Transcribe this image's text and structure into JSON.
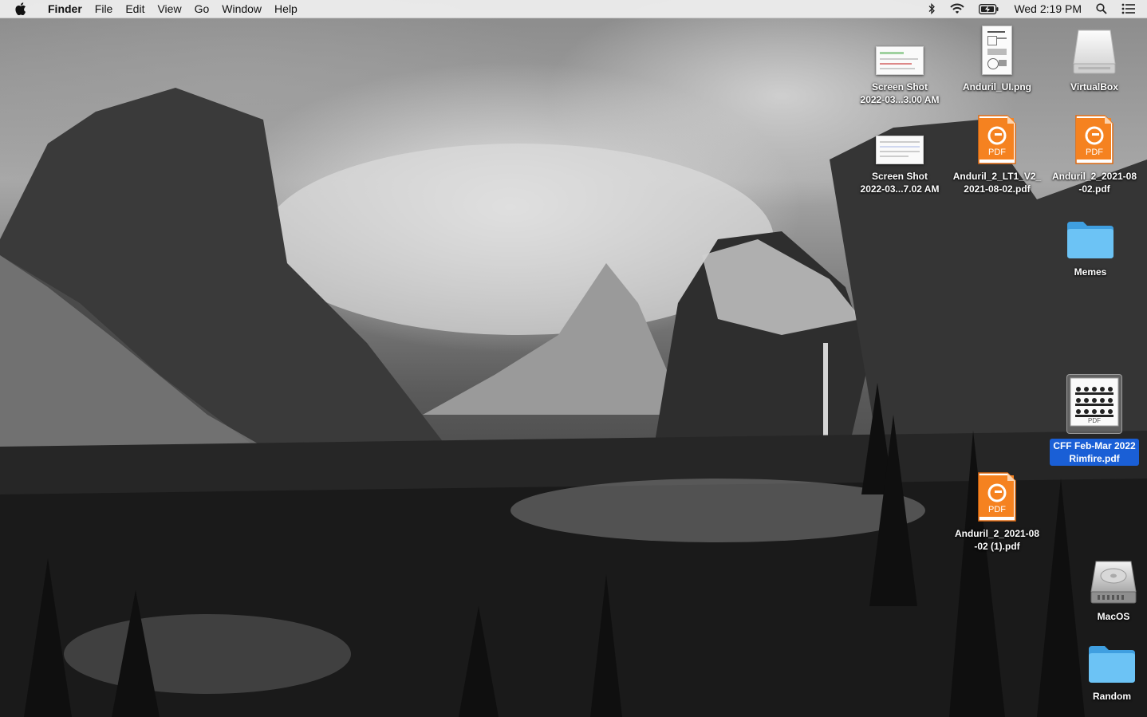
{
  "menubar": {
    "app_name": "Finder",
    "menus": [
      "File",
      "Edit",
      "View",
      "Go",
      "Window",
      "Help"
    ],
    "clock": "Wed 2:19 PM",
    "status_icons": [
      "bluetooth-icon",
      "wifi-icon",
      "battery-icon",
      "spotlight-icon",
      "notification-center-icon"
    ]
  },
  "desktop": {
    "icons": [
      {
        "name": "screenshot-1",
        "kind": "screenshot",
        "label_lines": [
          "Screen Shot",
          "2022-03...3.00 AM"
        ]
      },
      {
        "name": "anduril-ui-png",
        "kind": "png",
        "label_lines": [
          "Anduril_UI.png"
        ]
      },
      {
        "name": "virtualbox-drive",
        "kind": "drive",
        "label_lines": [
          "VirtualBox"
        ]
      },
      {
        "name": "screenshot-2",
        "kind": "screenshot",
        "label_lines": [
          "Screen Shot",
          "2022-03...7.02 AM"
        ]
      },
      {
        "name": "anduril-lt1-pdf",
        "kind": "pdf",
        "label_lines": [
          "Anduril_2_LT1_V2_",
          "2021-08-02.pdf"
        ]
      },
      {
        "name": "anduril-2021-pdf",
        "kind": "pdf",
        "label_lines": [
          "Anduril_2_2021-08",
          "-02.pdf"
        ]
      },
      {
        "name": "memes-folder",
        "kind": "folder",
        "label_lines": [
          "Memes"
        ]
      },
      {
        "name": "cff-rimfire-pdf",
        "kind": "pdf-preview",
        "selected": true,
        "label_lines": [
          "CFF Feb-Mar 2022",
          "Rimfire.pdf"
        ]
      },
      {
        "name": "anduril-2021-copy-pdf",
        "kind": "pdf",
        "label_lines": [
          "Anduril_2_2021-08",
          "-02 (1).pdf"
        ]
      },
      {
        "name": "macos-drive",
        "kind": "hdd",
        "label_lines": [
          "MacOS"
        ]
      },
      {
        "name": "random-folder",
        "kind": "folder",
        "label_lines": [
          "Random"
        ]
      }
    ],
    "pdf_badge": "PDF",
    "colors": {
      "folder": "#5ab8f0",
      "pdf": "#f58220",
      "selection": "#1a5fd6"
    }
  }
}
